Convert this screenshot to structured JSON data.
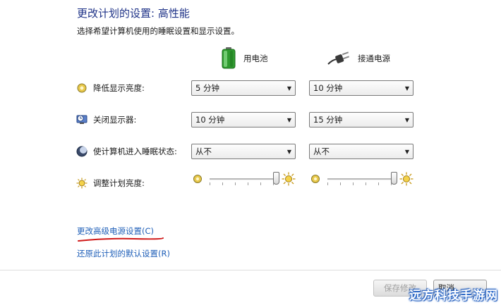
{
  "header": {
    "title": "更改计划的设置: 高性能",
    "subtitle": "选择希望计算机使用的睡眠设置和显示设置。"
  },
  "columns": {
    "battery_label": "用电池",
    "plugged_label": "接通电源"
  },
  "rows": {
    "dim_display": {
      "label": "降低显示亮度:",
      "battery_value": "5 分钟",
      "plugged_value": "10 分钟"
    },
    "turn_off_display": {
      "label": "关闭显示器:",
      "battery_value": "10 分钟",
      "plugged_value": "15 分钟"
    },
    "sleep": {
      "label": "使计算机进入睡眠状态:",
      "battery_value": "从不",
      "plugged_value": "从不"
    },
    "brightness": {
      "label": "调整计划亮度:",
      "battery_level": 1.0,
      "plugged_level": 1.0
    }
  },
  "links": {
    "advanced": "更改高级电源设置(C)",
    "restore": "还原此计划的默认设置(R)"
  },
  "buttons": {
    "save": "保存修改",
    "cancel": "取消"
  },
  "watermark": "远方科技手游网",
  "colors": {
    "title": "#1e3287",
    "link": "#1f5fb8",
    "annotation": "#d01818"
  }
}
